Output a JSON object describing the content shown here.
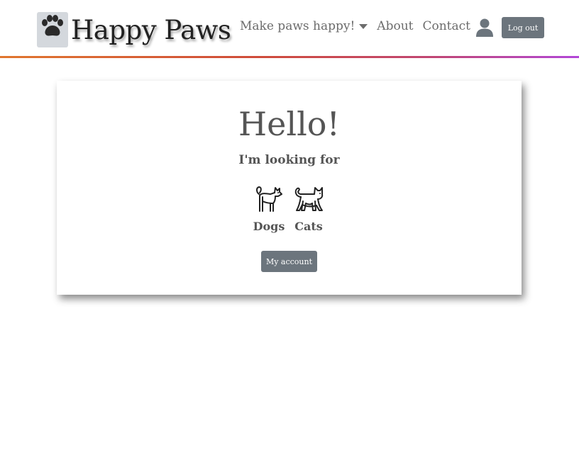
{
  "brand": {
    "name": "Happy Paws",
    "logo_icon": "paw-icon"
  },
  "nav": {
    "dropdown_label": "Make paws happy!",
    "about_label": "About",
    "contact_label": "Contact",
    "user_icon": "user-icon",
    "logout_label": "Log out"
  },
  "card": {
    "greeting": "Hello!",
    "prompt": "I'm looking for",
    "pets": [
      {
        "label": "Dogs",
        "icon": "dog-icon"
      },
      {
        "label": "Cats",
        "icon": "cat-icon"
      }
    ],
    "account_label": "My account"
  },
  "colors": {
    "button_bg": "#6c757d",
    "nav_text": "#6c6c6c",
    "gradient": [
      "#e0762e",
      "#cf4b3a",
      "#c04574",
      "#b246d8"
    ]
  }
}
